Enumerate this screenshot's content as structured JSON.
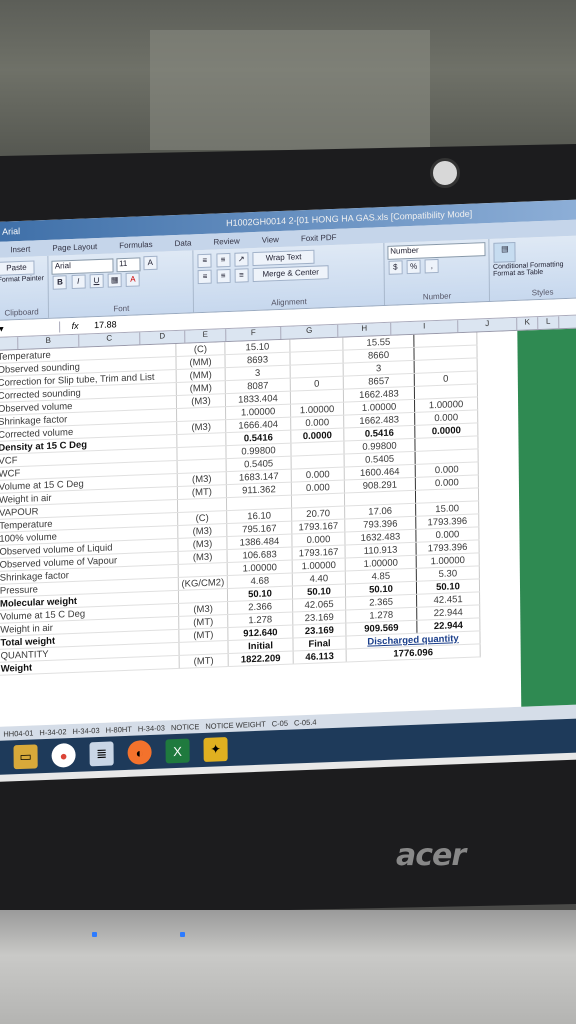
{
  "app": {
    "title": "H1002GH0014 2-[01 HONG HA GAS.xls [Compatibility Mode]",
    "font_name": "Arial",
    "font_size": "11",
    "tabs": [
      "Insert",
      "Page Layout",
      "Formulas",
      "Data",
      "Review",
      "View",
      "Foxit PDF"
    ],
    "ribbon": {
      "clipboard": {
        "paste": "Paste",
        "painter": "Format Painter",
        "label": "Clipboard"
      },
      "font_label": "Font",
      "wrap_text": "Wrap Text",
      "merge_center": "Merge & Center",
      "alignment_label": "Alignment",
      "number_format": "Number",
      "number_label": "Number",
      "conditional_formatting": "Conditional Formatting",
      "format_as_table": "Format as Table",
      "styles_label": "Styles"
    },
    "formula_value": "17.88",
    "fx": "fx",
    "columns": [
      "B",
      "C",
      "D",
      "E",
      "F",
      "G",
      "H",
      "I",
      "J",
      "K",
      "L"
    ]
  },
  "rows": [
    {
      "label": "Temperature",
      "unit": "(C)",
      "c1": "15.10",
      "c2": "",
      "c3": "15.55",
      "c4": ""
    },
    {
      "label": "Observed sounding",
      "unit": "(MM)",
      "c1": "8693",
      "c2": "",
      "c3": "8660",
      "c4": ""
    },
    {
      "label": "Correction for Slip tube, Trim and List",
      "unit": "(MM)",
      "c1": "3",
      "c2": "",
      "c3": "3",
      "c4": ""
    },
    {
      "label": "Corrected sounding",
      "unit": "(MM)",
      "c1": "8087",
      "c2": "0",
      "c3": "8657",
      "c4": "0"
    },
    {
      "label": "Observed volume",
      "unit": "(M3)",
      "c1": "1833.404",
      "c2": "",
      "c3": "1662.483",
      "c4": ""
    },
    {
      "label": "Shrinkage factor",
      "unit": "",
      "c1": "1.00000",
      "c2": "1.00000",
      "c3": "1.00000",
      "c4": "1.00000"
    },
    {
      "label": "Corrected volume",
      "unit": "(M3)",
      "c1": "1666.404",
      "c2": "0.000",
      "c3": "1662.483",
      "c4": "0.000"
    },
    {
      "label": "Density at 15 C Deg",
      "unit": "",
      "c1": "0.5416",
      "c2": "0.0000",
      "c3": "0.5416",
      "c4": "0.0000",
      "bold": true
    },
    {
      "label": "VCF",
      "unit": "",
      "c1": "0.99800",
      "c2": "",
      "c3": "0.99800",
      "c4": ""
    },
    {
      "label": "WCF",
      "unit": "",
      "c1": "0.5405",
      "c2": "",
      "c3": "0.5405",
      "c4": ""
    },
    {
      "label": "Volume at 15 C Deg",
      "unit": "(M3)",
      "c1": "1683.147",
      "c2": "0.000",
      "c3": "1600.464",
      "c4": "0.000"
    },
    {
      "label": "Weight in air",
      "unit": "(MT)",
      "c1": "911.362",
      "c2": "0.000",
      "c3": "908.291",
      "c4": "0.000"
    },
    {
      "label": "VAPOUR",
      "unit": "",
      "c1": "",
      "c2": "",
      "c3": "",
      "c4": ""
    },
    {
      "label": "Temperature",
      "unit": "(C)",
      "c1": "16.10",
      "c2": "20.70",
      "c3": "17.06",
      "c4": "15.00"
    },
    {
      "label": "100% volume",
      "unit": "(M3)",
      "c1": "795.167",
      "c2": "1793.167",
      "c3": "793.396",
      "c4": "1793.396"
    },
    {
      "label": "Observed volume of Liquid",
      "unit": "(M3)",
      "c1": "1386.484",
      "c2": "0.000",
      "c3": "1632.483",
      "c4": "0.000"
    },
    {
      "label": "Observed volume of Vapour",
      "unit": "(M3)",
      "c1": "106.683",
      "c2": "1793.167",
      "c3": "110.913",
      "c4": "1793.396"
    },
    {
      "label": "Shrinkage factor",
      "unit": "",
      "c1": "1.00000",
      "c2": "1.00000",
      "c3": "1.00000",
      "c4": "1.00000"
    },
    {
      "label": "Pressure",
      "unit": "(KG/CM2)",
      "c1": "4.68",
      "c2": "4.40",
      "c3": "4.85",
      "c4": "5.30"
    },
    {
      "label": "Molecular weight",
      "unit": "",
      "c1": "50.10",
      "c2": "50.10",
      "c3": "50.10",
      "c4": "50.10",
      "bold": true
    },
    {
      "label": "Volume at 15 C Deg",
      "unit": "(M3)",
      "c1": "2.366",
      "c2": "42.065",
      "c3": "2.365",
      "c4": "42.451"
    },
    {
      "label": "Weight in air",
      "unit": "(MT)",
      "c1": "1.278",
      "c2": "23.169",
      "c3": "1.278",
      "c4": "22.944"
    },
    {
      "label": "Total weight",
      "unit": "(MT)",
      "c1": "912.640",
      "c2": "23.169",
      "c3": "909.569",
      "c4": "22.944",
      "bold": true
    }
  ],
  "summary": {
    "quantity_label": "QUANTITY",
    "weight_label": "Weight",
    "unit": "(MT)",
    "initial_label": "Initial",
    "initial_value": "1822.209",
    "final_label": "Final",
    "final_value": "46.113",
    "discharged_label": "Discharged quantity",
    "discharged_value": "1776.096"
  },
  "sheet_tabs": [
    "HH04-01",
    "H-34-02",
    "H-34-03",
    "H-80HT",
    "H-34-03",
    "NOTICE",
    "NOTICE WEIGHT",
    "C-05",
    "C-05.4"
  ],
  "laptop_brand": "acer"
}
